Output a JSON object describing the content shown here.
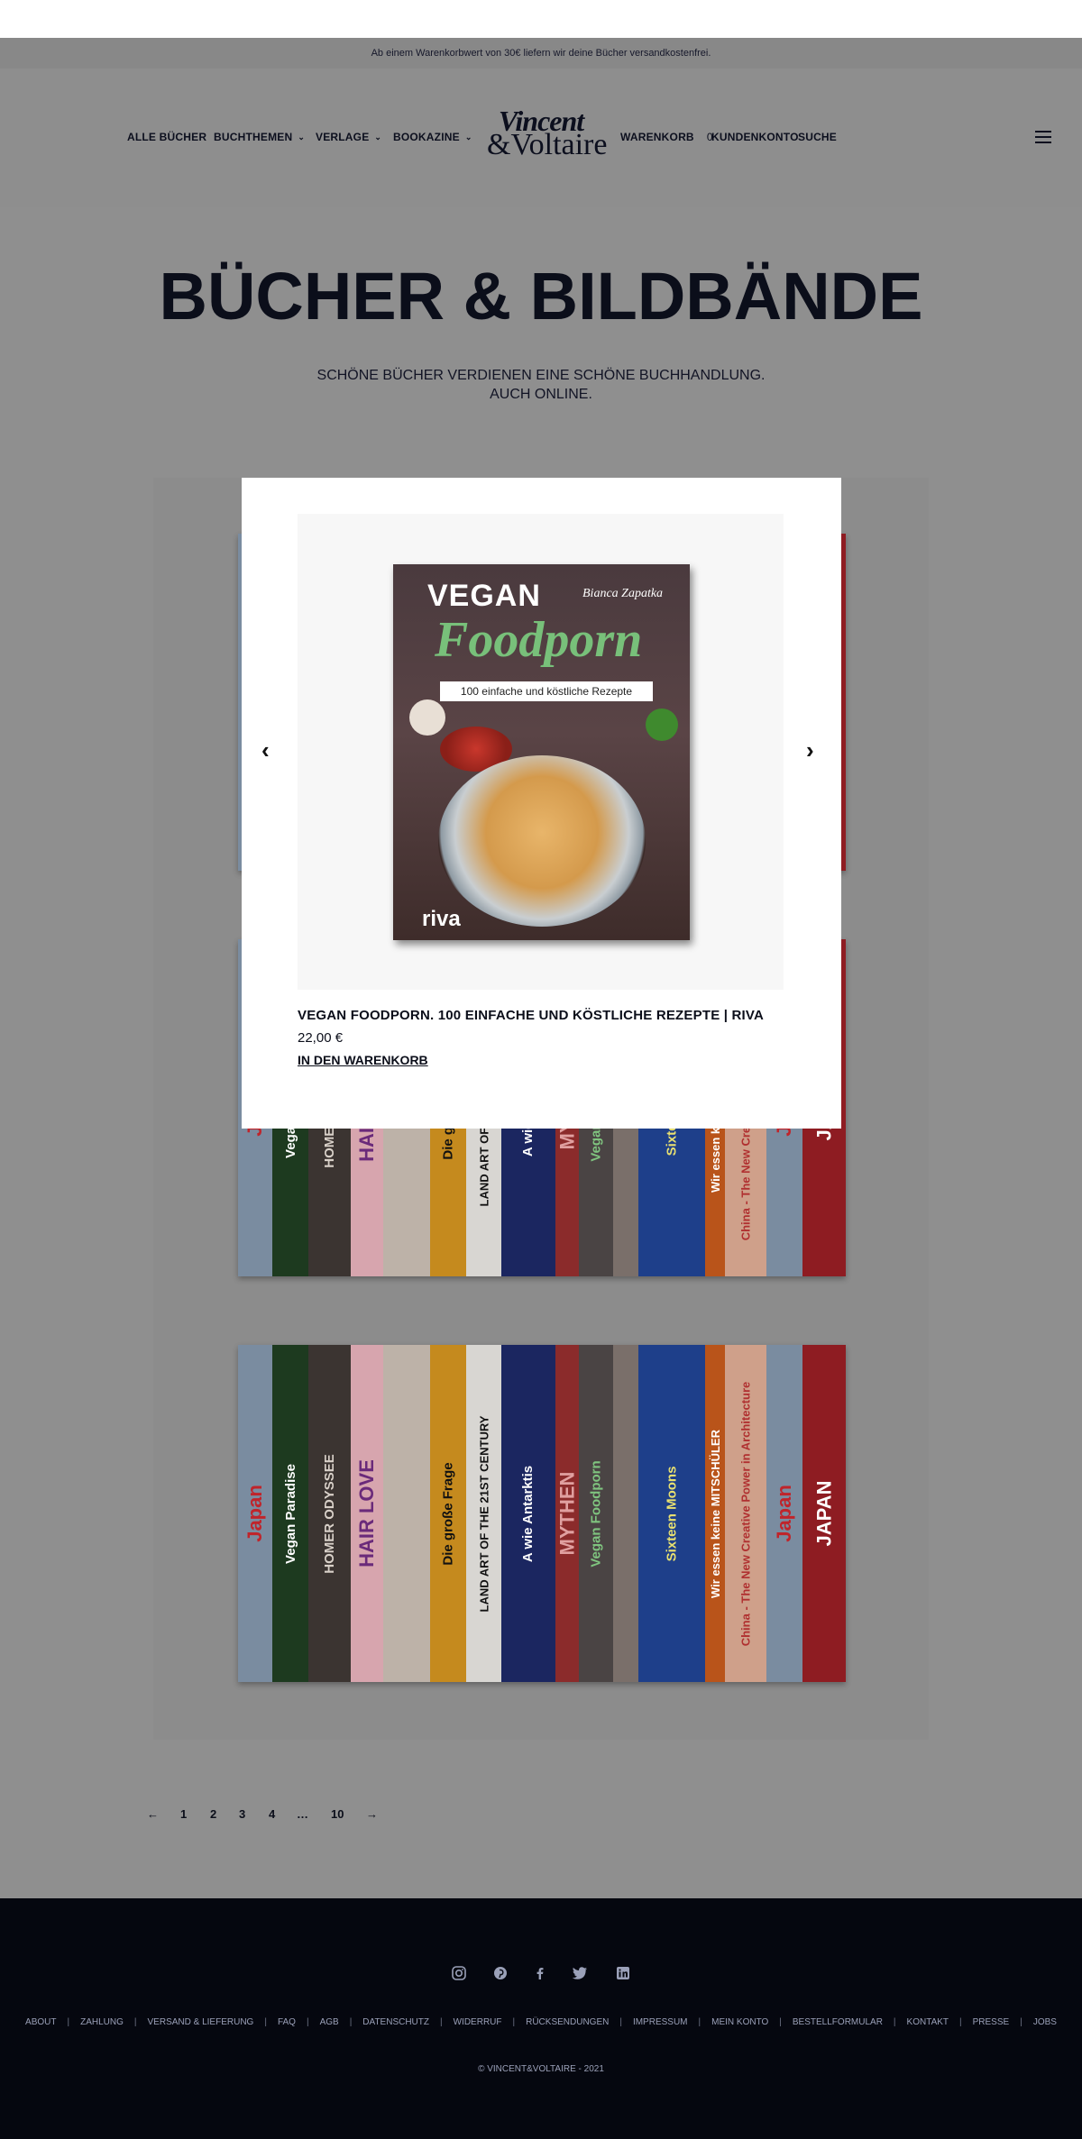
{
  "notice": "Ab einem Warenkorbwert von 30€ liefern wir deine Bücher versandkostenfrei.",
  "nav": {
    "alle_buecher": "ALLE BÜCHER",
    "buchthemen": "BUCHTHEMEN",
    "verlage": "VERLAGE",
    "bookazine": "BOOKAZINE",
    "warenkorb": "WARENKORB",
    "cart_count": "0",
    "kundenkonto": "KUNDENKONTO",
    "suche": "SUCHE"
  },
  "logo": {
    "line1": "Vincent",
    "line2": "&Voltaire"
  },
  "page": {
    "title": "BÜCHER & BILDBÄNDE",
    "subtitle_1": "SCHÖNE BÜCHER VERDIENEN EINE SCHÖNE BUCHHANDLUNG.",
    "subtitle_2": "AUCH ONLINE."
  },
  "modal": {
    "cover": {
      "word1": "VEGAN",
      "word2": "Foodporn",
      "author": "Bianca Zapatka",
      "ribbon": "100 einfache und köstliche Rezepte",
      "publisher": "riva"
    },
    "product_title": "VEGAN FOODPORN. 100 EINFACHE UND KÖSTLICHE REZEPTE | RIVA",
    "price": "22,00 €",
    "add_to_cart": "IN DEN WARENKORB",
    "prev_arrow": "‹",
    "next_arrow": "›"
  },
  "shelf": {
    "spines": [
      {
        "label": "Japan",
        "bg": "#7a8ca0",
        "fg": "#c0242a"
      },
      {
        "label": "Vegan Paradise",
        "bg": "#1d3a1f",
        "fg": "#ffffff"
      },
      {
        "label": "HOMER ODYSSEE",
        "bg": "#3b3431",
        "fg": "#d8d0c8"
      },
      {
        "label": "HAIR LOVE",
        "bg": "#d7a5ae",
        "fg": "#6a2a7a"
      },
      {
        "label": "",
        "bg": "#bdb2a8",
        "fg": "#333333"
      },
      {
        "label": "Die große Frage",
        "bg": "#c58a1e",
        "fg": "#111111"
      },
      {
        "label": "LAND ART OF THE 21ST CENTURY",
        "bg": "#d8d6d2",
        "fg": "#111111"
      },
      {
        "label": "A wie Antarktis",
        "bg": "#1b2660",
        "fg": "#ffffff"
      },
      {
        "label": "MYTHEN",
        "bg": "#8b2b2b",
        "fg": "#e0a0a0"
      },
      {
        "label": "Vegan Foodporn",
        "bg": "#4a4444",
        "fg": "#7fc47f"
      },
      {
        "label": "",
        "bg": "#7a6f6a",
        "fg": "#ffffff"
      },
      {
        "label": "Sixteen Moons",
        "bg": "#1e3f8a",
        "fg": "#e8e070"
      },
      {
        "label": "Wir essen keine MITSCHÜLER",
        "bg": "#b9541a",
        "fg": "#ffffff"
      },
      {
        "label": "China - The New Creative Power in Architecture",
        "bg": "#cfa08a",
        "fg": "#b03030"
      },
      {
        "label": "Japan",
        "bg": "#7a8ca0",
        "fg": "#c0242a"
      },
      {
        "label": "JAPAN",
        "bg": "#8e1c22",
        "fg": "#ffffff"
      }
    ]
  },
  "pagination": {
    "prev": "←",
    "pages": [
      "1",
      "2",
      "3",
      "4",
      "…",
      "10"
    ],
    "next": "→"
  },
  "footer": {
    "social": [
      "instagram-icon",
      "pinterest-icon",
      "facebook-icon",
      "twitter-icon",
      "linkedin-icon"
    ],
    "links": [
      "ABOUT",
      "ZAHLUNG",
      "VERSAND & LIEFERUNG",
      "FAQ",
      "AGB",
      "DATENSCHUTZ",
      "WIDERRUF",
      "RÜCKSENDUNGEN",
      "IMPRESSUM",
      "MEIN KONTO",
      "BESTELLFORMULAR",
      "KONTAKT",
      "PRESSE",
      "JOBS"
    ],
    "copyright": "© VINCENT&VOLTAIRE - 2021"
  }
}
